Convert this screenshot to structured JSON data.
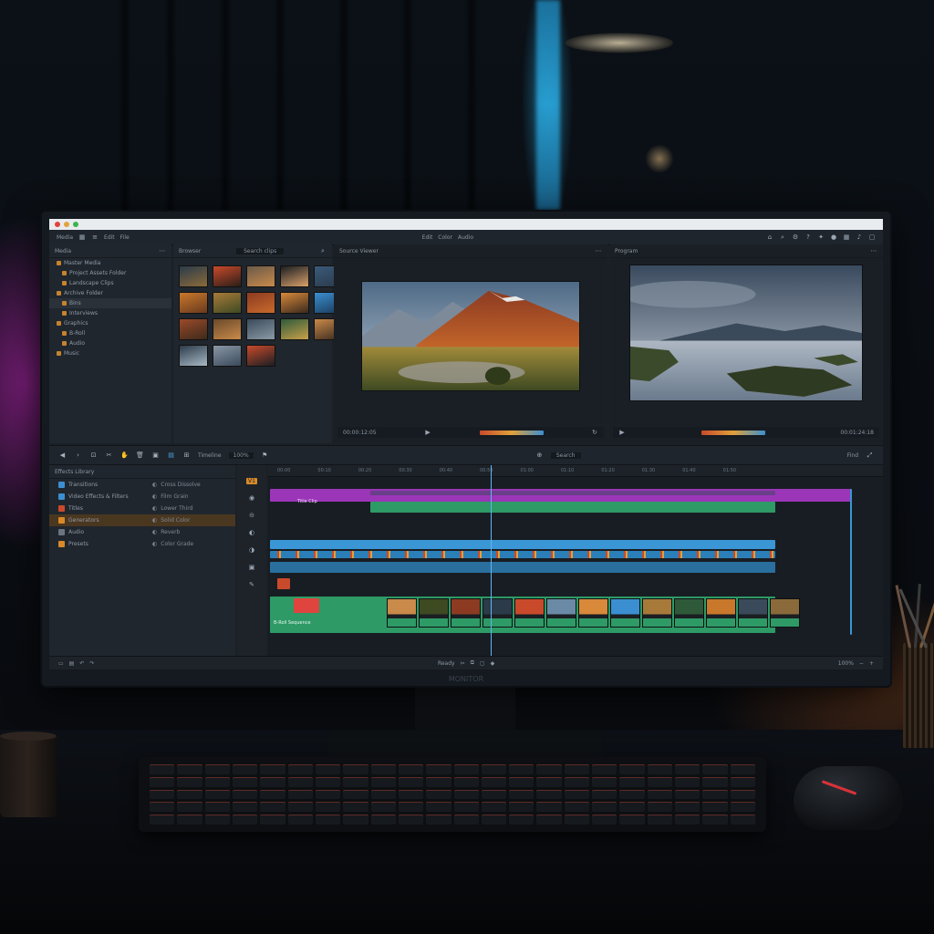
{
  "window": {
    "title_dots": [
      "#e0443e",
      "#e2a33a",
      "#3bb54a"
    ]
  },
  "menubar": {
    "left_items": [
      "Media",
      "Edit",
      "File"
    ],
    "center_items": [
      "Edit",
      "Color",
      "Audio"
    ],
    "right_icons": [
      "home-icon",
      "search-icon",
      "gear-icon",
      "help-icon",
      "settings-icon",
      "user-icon",
      "grid-icon",
      "bell-icon",
      "window-icon"
    ]
  },
  "media_panel": {
    "header": "Media",
    "items": [
      {
        "label": "Master Media",
        "highlight": false
      },
      {
        "label": "Project Assets Folder",
        "highlight": false
      },
      {
        "label": "Landscape Clips",
        "highlight": false
      },
      {
        "label": "Archive Folder",
        "highlight": false
      },
      {
        "label": "Bins",
        "highlight": true
      },
      {
        "label": "Interviews",
        "highlight": false
      },
      {
        "label": "Graphics",
        "highlight": false
      },
      {
        "label": "B-Roll",
        "highlight": false
      },
      {
        "label": "Audio",
        "highlight": false
      },
      {
        "label": "Music",
        "highlight": false
      }
    ]
  },
  "thumbs_panel": {
    "header": "Browser",
    "search_placeholder": "Search clips"
  },
  "viewer_source": {
    "header": "Source Viewer",
    "timecode": "00:00:12:05"
  },
  "viewer_program": {
    "header": "Program",
    "timecode": "00:01:24:18"
  },
  "toolbar": {
    "zoom_label": "Timeline",
    "zoom_value": "100%",
    "search_label": "Search",
    "right_label": "Find"
  },
  "fx_panel": {
    "header": "Effects Library",
    "rows": [
      {
        "label": "Transitions",
        "right": "Cross Dissolve",
        "color": "#3b8fd0",
        "highlight": false
      },
      {
        "label": "Video Effects & Filters",
        "right": "Film Grain",
        "color": "#3b8fd0",
        "highlight": false
      },
      {
        "label": "Titles",
        "right": "Lower Third",
        "color": "#c94a2b",
        "highlight": false
      },
      {
        "label": "Generators",
        "right": "Solid Color",
        "color": "#d8892a",
        "highlight": true
      },
      {
        "label": "Audio",
        "right": "Reverb",
        "color": "#6a7581",
        "highlight": false
      },
      {
        "label": "Presets",
        "right": "Color Grade",
        "color": "#d8892a",
        "highlight": false
      }
    ]
  },
  "track_tools": {
    "tag": "V1"
  },
  "timeline": {
    "ruler": [
      "00:00",
      "00:10",
      "00:20",
      "00:30",
      "00:40",
      "00:50",
      "01:00",
      "01:10",
      "01:20",
      "01:30",
      "01:40",
      "01:50"
    ],
    "title_clip_label": "Title Clip",
    "broll_label": "B-Roll Sequence"
  },
  "statusbar": {
    "center_label": "Ready",
    "zoom": "100%"
  },
  "monitor": {
    "brand": "MONITOR"
  }
}
